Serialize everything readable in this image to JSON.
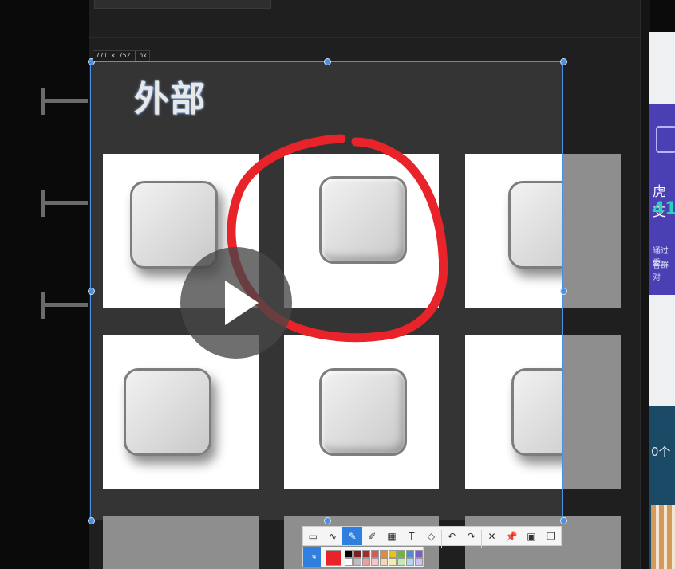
{
  "selection": {
    "size_text": "771 × 752",
    "unit": "px"
  },
  "board": {
    "title": "外部"
  },
  "right_panel": {
    "text1": "虎支",
    "text2": "41",
    "text3": "通过重",
    "text4": "客群对",
    "text5": "0个"
  },
  "toolbar": {
    "tools": [
      "rect-tool-icon",
      "curve-tool-icon",
      "pen-tool-icon",
      "marker-tool-icon",
      "mosaic-tool-icon",
      "text-tool-icon",
      "eraser-tool-icon",
      "undo-icon",
      "redo-icon",
      "close-icon",
      "pin-icon",
      "save-icon",
      "copy-icon"
    ],
    "tool_glyphs": [
      "▭",
      "∿",
      "✎",
      "✐",
      "▦",
      "T",
      "◇",
      "↶",
      "↷",
      "✕",
      "📌",
      "▣",
      "❐"
    ],
    "active_tool": "pen-tool-icon",
    "pen_width": "19",
    "current_color": "#e8232a",
    "palette_top": [
      "#000000",
      "#7a1e1e",
      "#a52a2a",
      "#d35b5b",
      "#e08c3a",
      "#e6c21c",
      "#6fb34a",
      "#4a8fd0",
      "#7b5bd0"
    ],
    "palette_bottom": [
      "#ffffff",
      "#bdbdbd",
      "#e8a0a0",
      "#f0c7c7",
      "#f3d9b0",
      "#f3ecb0",
      "#c6e6b4",
      "#b6d3f0",
      "#cfc2ef"
    ]
  },
  "annotation": {
    "stroke_color": "#e8232a"
  }
}
